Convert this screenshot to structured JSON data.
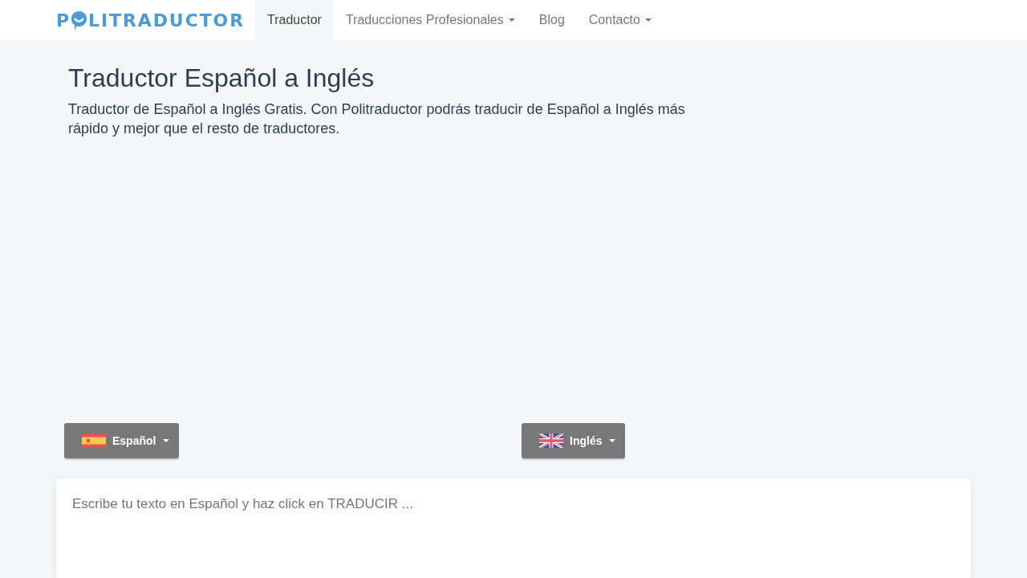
{
  "navbar": {
    "logo": {
      "lead": "P",
      "tail": "LITRADUCTOR"
    },
    "items": [
      {
        "label": "Traductor",
        "selected": true,
        "dropdown": false
      },
      {
        "label": "Traducciones Profesionales",
        "selected": false,
        "dropdown": true
      },
      {
        "label": "Blog",
        "selected": false,
        "dropdown": false
      },
      {
        "label": "Contacto",
        "selected": false,
        "dropdown": true
      }
    ]
  },
  "header": {
    "title": "Traductor Español a Inglés",
    "description": "Traductor de Español a Inglés Gratis. Con Politraductor podrás traducir de Español a Inglés más rápido y mejor que el resto de traductores."
  },
  "language_buttons": [
    {
      "label": "Español",
      "kind": "spain"
    },
    {
      "label": "Inglés",
      "kind": "uk"
    }
  ],
  "input": {
    "placeholder": "Escribe tu texto en Español y haz click en TRADUCIR ..."
  }
}
